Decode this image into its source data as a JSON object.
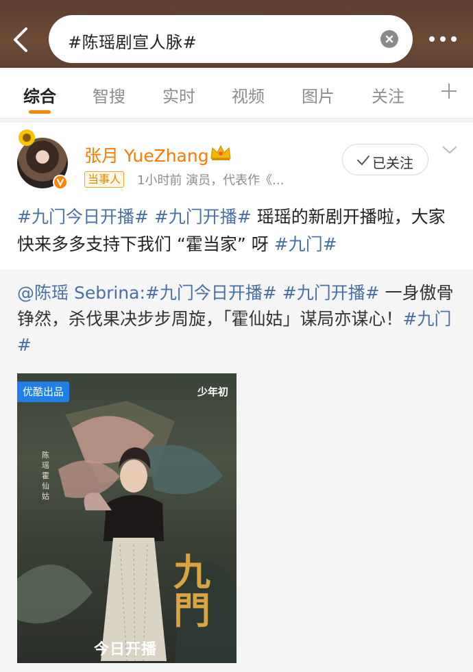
{
  "header": {
    "search_query": "#陈瑶剧宣人脉#",
    "back_icon": "back-arrow-icon",
    "clear_icon": "clear-icon",
    "more_icon": "more-dots-icon"
  },
  "tabs": [
    {
      "label": "综合",
      "active": true
    },
    {
      "label": "智搜",
      "active": false
    },
    {
      "label": "实时",
      "active": false
    },
    {
      "label": "视频",
      "active": false
    },
    {
      "label": "图片",
      "active": false
    },
    {
      "label": "关注",
      "active": false
    }
  ],
  "tab_add_icon": "plus-icon",
  "post": {
    "username": "张月 YueZhang",
    "source_tag": "当事人",
    "meta": "1小时前  演员，代表作《...",
    "follow_label": "已关注",
    "text_parts": [
      {
        "text": "#九门今日开播#",
        "tag": true
      },
      {
        "text": " ",
        "tag": false
      },
      {
        "text": "#九门开播#",
        "tag": true
      },
      {
        "text": " 瑶瑶的新剧开播啦，大家快来多多支持下我们 “霍当家” 呀 ",
        "tag": false
      },
      {
        "text": "#九门#",
        "tag": true
      }
    ]
  },
  "repost": {
    "text_parts": [
      {
        "text": "@陈瑶 Sebrina:",
        "tag": true
      },
      {
        "text": "#九门今日开播#",
        "tag": true
      },
      {
        "text": " ",
        "tag": false
      },
      {
        "text": "#九门开播#",
        "tag": true
      },
      {
        "text": "  一身傲骨铮然，杀伐果决步步周旋，「霍仙姑」谋局亦谋心！",
        "tag": false
      },
      {
        "text": "#九门#",
        "tag": true
      }
    ],
    "poster": {
      "badge": "优酷出品",
      "logo": "少年初",
      "title": "今日开播",
      "side_text": "陈瑶 霍仙姑",
      "calligraphy": "九門"
    }
  },
  "colors": {
    "accent": "#ff8200",
    "username": "#ff7a00",
    "hashtag": "#4a6fa5",
    "header_bg": "#5a3d2e"
  }
}
